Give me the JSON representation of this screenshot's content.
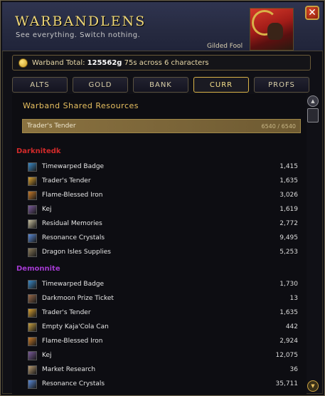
{
  "header": {
    "title": "WARBANDLENS",
    "subtitle": "See everything. Switch nothing.",
    "character_name": "Gilded Fool",
    "close_label": "✕"
  },
  "total_bar": {
    "prefix": "Warband Total:",
    "gold": "125562g",
    "rest": "75s across 6 characters"
  },
  "tabs": [
    {
      "label": "ALTS"
    },
    {
      "label": "GOLD"
    },
    {
      "label": "BANK"
    },
    {
      "label": "CURR",
      "active": true
    },
    {
      "label": "PROFS"
    }
  ],
  "section_title": "Warband Shared Resources",
  "shared": {
    "name": "Trader's Tender",
    "qty": "6540 / 6540"
  },
  "characters": [
    {
      "name": "Darknitedk",
      "color": "#d12a2a",
      "items": [
        {
          "name": "Timewarped Badge",
          "value": "1,415",
          "icon": "timewarped-badge-icon",
          "color": "#3a8ac8"
        },
        {
          "name": "Trader's Tender",
          "value": "1,635",
          "icon": "traders-tender-icon",
          "color": "#d9a030"
        },
        {
          "name": "Flame-Blessed Iron",
          "value": "3,026",
          "icon": "flame-blessed-iron-icon",
          "color": "#c87a28"
        },
        {
          "name": "Kej",
          "value": "1,619",
          "icon": "kej-icon",
          "color": "#7a5a9a"
        },
        {
          "name": "Residual Memories",
          "value": "2,772",
          "icon": "residual-memories-icon",
          "color": "#c8c0a0"
        },
        {
          "name": "Resonance Crystals",
          "value": "9,495",
          "icon": "resonance-crystals-icon",
          "color": "#5a8ad8"
        },
        {
          "name": "Dragon Isles Supplies",
          "value": "5,253",
          "icon": "dragon-isles-supplies-icon",
          "color": "#8a7a5a"
        }
      ]
    },
    {
      "name": "Demonnite",
      "color": "#a33ad1",
      "items": [
        {
          "name": "Timewarped Badge",
          "value": "1,730",
          "icon": "timewarped-badge-icon",
          "color": "#3a8ac8"
        },
        {
          "name": "Darkmoon Prize Ticket",
          "value": "13",
          "icon": "darkmoon-prize-ticket-icon",
          "color": "#9a6a4a"
        },
        {
          "name": "Trader's Tender",
          "value": "1,635",
          "icon": "traders-tender-icon",
          "color": "#d9a030"
        },
        {
          "name": "Empty Kaja'Cola Can",
          "value": "442",
          "icon": "kaja-cola-can-icon",
          "color": "#c8a040"
        },
        {
          "name": "Flame-Blessed Iron",
          "value": "2,924",
          "icon": "flame-blessed-iron-icon",
          "color": "#c87a28"
        },
        {
          "name": "Kej",
          "value": "12,075",
          "icon": "kej-icon",
          "color": "#7a5a9a"
        },
        {
          "name": "Market Research",
          "value": "36",
          "icon": "market-research-icon",
          "color": "#b89a70"
        },
        {
          "name": "Resonance Crystals",
          "value": "35,711",
          "icon": "resonance-crystals-icon",
          "color": "#5a8ad8"
        }
      ]
    }
  ]
}
